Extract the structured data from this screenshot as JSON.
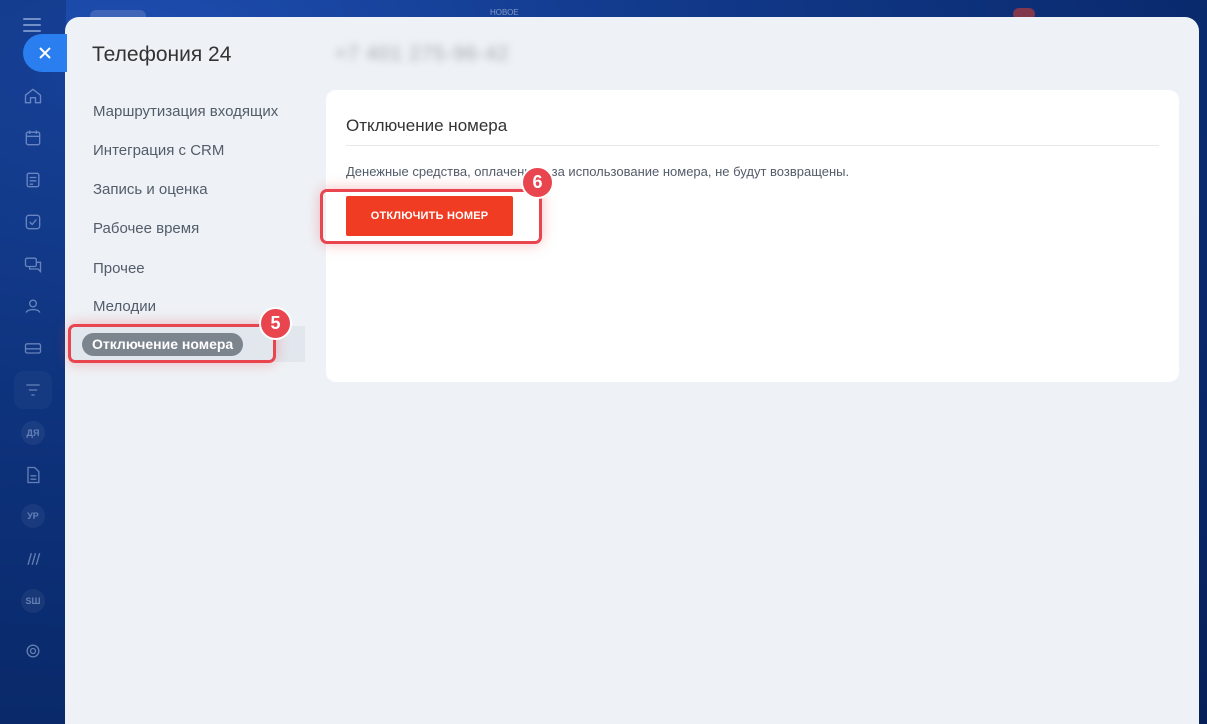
{
  "topbar": {
    "new_label": "НОВОЕ"
  },
  "rail": {
    "badges": [
      "ДЯ",
      "УР",
      "SШ"
    ]
  },
  "panel": {
    "title": "Телефония 24",
    "phone_number_blurred": "+7 401 275-96-42"
  },
  "menu": {
    "items": [
      "Маршрутизация входящих",
      "Интеграция с CRM",
      "Запись и оценка",
      "Рабочее время",
      "Прочее",
      "Мелодии",
      "Отключение номера"
    ],
    "active_index": 6
  },
  "card": {
    "title": "Отключение номера",
    "description": "Денежные средства, оплаченные за использование номера, не будут возвращены.",
    "button_label": "ОТКЛЮЧИТЬ НОМЕР"
  },
  "steps": [
    "5",
    "6"
  ],
  "colors": {
    "accent_red": "#f03c22",
    "highlight_red": "#e8454f",
    "close_blue": "#2a7ef0",
    "panel_bg": "#eef2f6"
  }
}
